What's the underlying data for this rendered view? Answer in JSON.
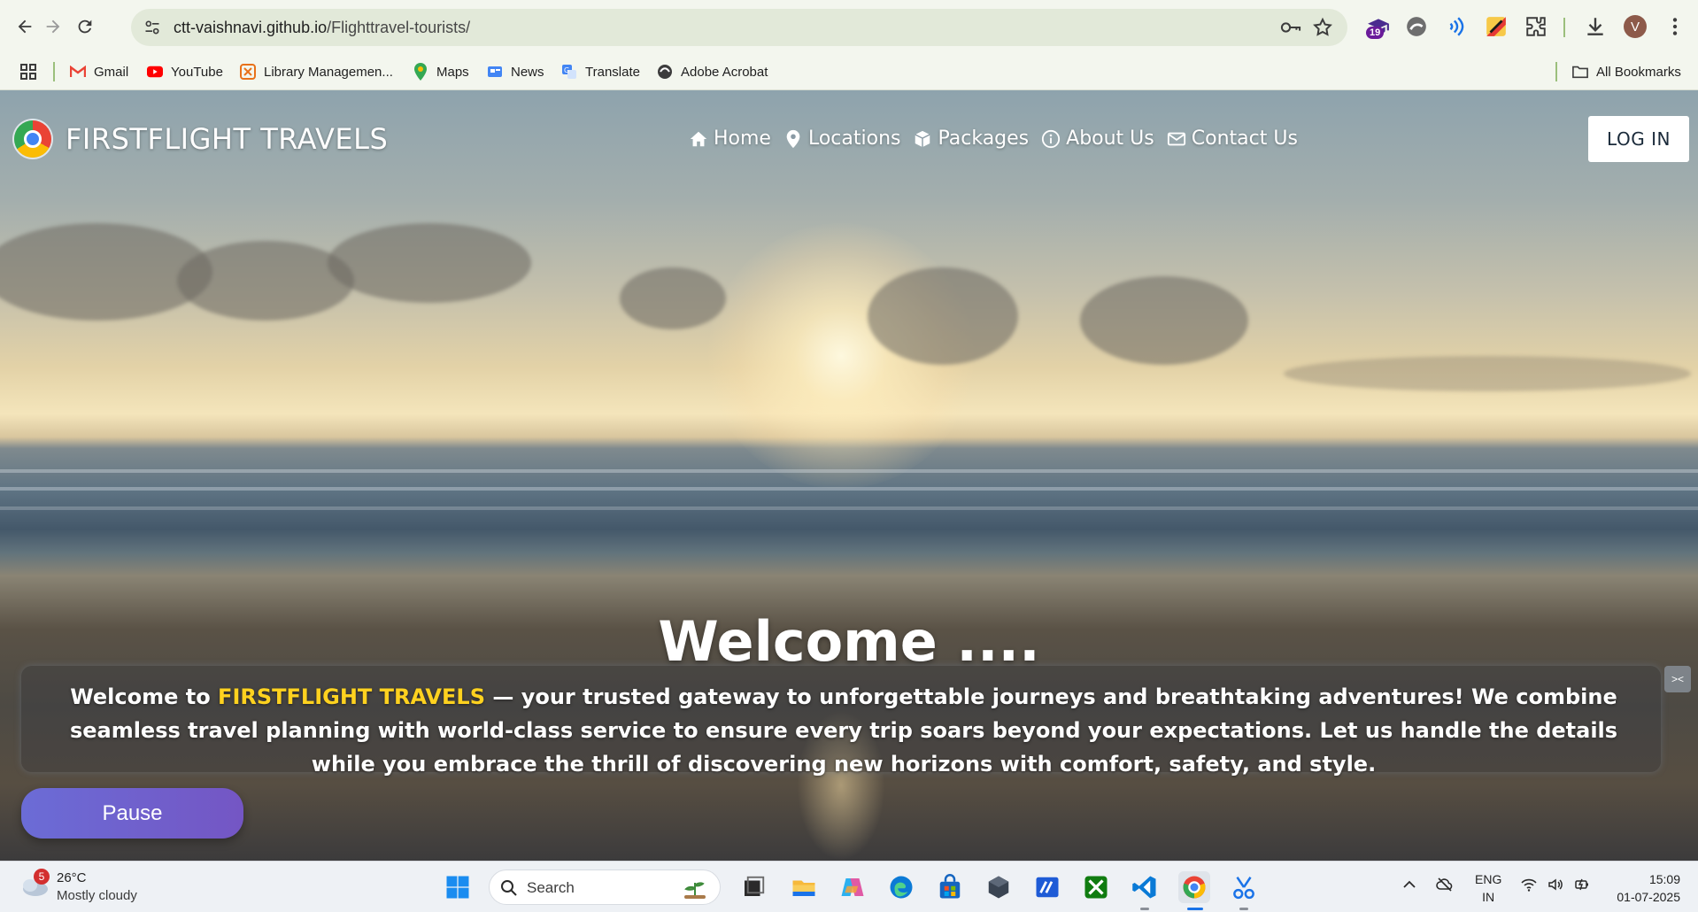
{
  "browser": {
    "url_host": "ctt-vaishnavi.github.io",
    "url_path": "/Flighttravel-tourists/",
    "extension_badge": "19",
    "profile_initial": "V",
    "icons": [
      "back-icon",
      "forward-icon",
      "reload-icon",
      "site-info-icon",
      "key-icon",
      "star-icon",
      "extensions-icon",
      "download-icon",
      "menu-icon"
    ]
  },
  "bookmarks": {
    "items": [
      {
        "label": "Gmail",
        "icon": "gmail-icon"
      },
      {
        "label": "YouTube",
        "icon": "youtube-icon"
      },
      {
        "label": "Library Managemen...",
        "icon": "library-icon"
      },
      {
        "label": "Maps",
        "icon": "maps-icon"
      },
      {
        "label": "News",
        "icon": "news-icon"
      },
      {
        "label": "Translate",
        "icon": "translate-icon"
      },
      {
        "label": "Adobe Acrobat",
        "icon": "acrobat-icon"
      }
    ],
    "all_bookmarks": "All Bookmarks"
  },
  "site": {
    "brand": "FIRSTFLIGHT TRAVELS",
    "nav": [
      {
        "label": "Home",
        "icon": "home-icon"
      },
      {
        "label": "Locations",
        "icon": "location-pin-icon"
      },
      {
        "label": "Packages",
        "icon": "package-box-icon"
      },
      {
        "label": "About Us",
        "icon": "info-icon"
      },
      {
        "label": "Contact Us",
        "icon": "envelope-icon"
      }
    ],
    "login": "LOG IN",
    "heading": "Welcome ....",
    "intro_prefix": "Welcome to ",
    "intro_brand": "FIRSTFLIGHT TRAVELS",
    "intro_rest": " — your trusted gateway to unforgettable journeys and breathtaking adventures! We combine seamless travel planning with world-class service to ensure every trip soars beyond your expectations. Let us handle the details while you embrace the thrill of discovering new horizons with comfort, safety, and style.",
    "pause_button": "Pause",
    "accent_color": "#ffd21f"
  },
  "taskbar": {
    "weather_badge": "5",
    "temperature": "26°C",
    "condition": "Mostly cloudy",
    "search_placeholder": "Search",
    "lang_line1": "ENG",
    "lang_line2": "IN",
    "time": "15:09",
    "date": "01-07-2025"
  }
}
